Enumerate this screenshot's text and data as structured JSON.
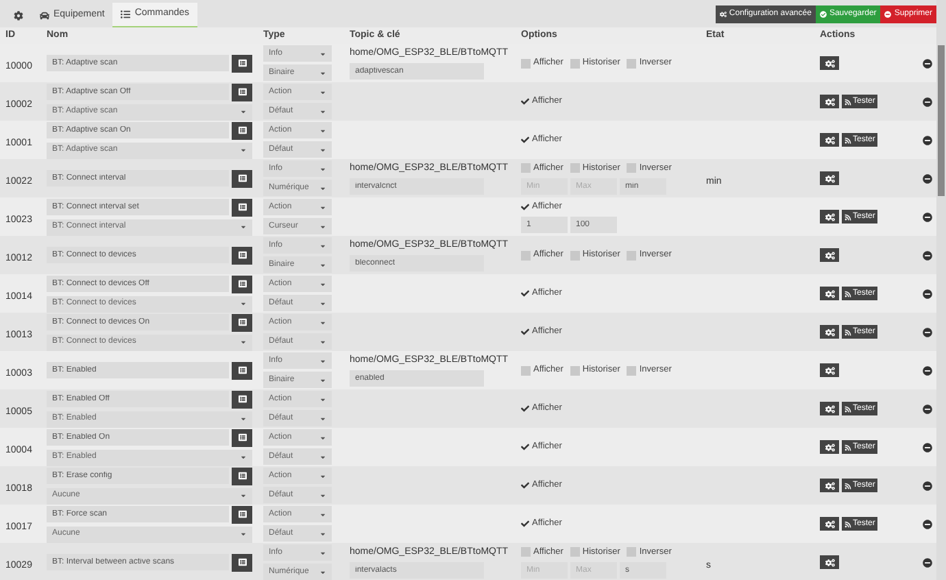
{
  "tabs": [
    {
      "kind": "icon",
      "selected": false
    },
    {
      "kind": "equipment",
      "label": "Equipement",
      "selected": false
    },
    {
      "kind": "commands",
      "label": "Commandes",
      "selected": true
    }
  ],
  "actions": [
    {
      "kind": "config",
      "label": "Configuration avancée"
    },
    {
      "kind": "save",
      "label": "Sauvegarder"
    },
    {
      "kind": "delete",
      "label": "Supprimer"
    }
  ],
  "columns": [
    "ID",
    "Nom",
    "Type",
    "Topic & clé",
    "Options",
    "Etat",
    "Actions"
  ],
  "rows": [
    {
      "kind": "info",
      "id": "10000",
      "name": "BT: Adaptive scan",
      "type": "Info",
      "subtype": "Binaire",
      "topic": "home/OMG_ESP32_BLE/BTtoMQTT",
      "key": "adaptivescan",
      "options": [
        {
          "label": "Afficher",
          "checked": false
        },
        {
          "label": "Historiser",
          "checked": false
        },
        {
          "label": "Inverser",
          "checked": false
        }
      ]
    },
    {
      "kind": "action",
      "id": "10002",
      "name": "BT: Adaptive scan Off",
      "value": "BT: Adaptive scan",
      "type": "Action",
      "subtype": "Défaut",
      "options": [
        {
          "label": "Afficher",
          "checked": true
        }
      ],
      "test": "Tester"
    },
    {
      "kind": "action",
      "id": "10001",
      "name": "BT: Adaptive scan On",
      "value": "BT: Adaptive scan",
      "type": "Action",
      "subtype": "Défaut",
      "options": [
        {
          "label": "Afficher",
          "checked": true
        }
      ],
      "test": "Tester"
    },
    {
      "kind": "info",
      "id": "10022",
      "name": "BT: Connect interval",
      "type": "Info",
      "subtype": "Numérique",
      "topic": "home/OMG_ESP32_BLE/BTtoMQTT",
      "key": "intervalcnct",
      "options": [
        {
          "label": "Afficher",
          "checked": false
        },
        {
          "label": "Historiser",
          "checked": false
        },
        {
          "label": "Inverser",
          "checked": false
        }
      ],
      "range": {
        "min_placeholder": "Min",
        "max_placeholder": "Max",
        "unit": "min"
      },
      "state": "min"
    },
    {
      "kind": "action",
      "id": "10023",
      "name": "BT: Connect interval set",
      "value": "BT: Connect interval",
      "type": "Action",
      "subtype": "Curseur",
      "options": [
        {
          "label": "Afficher",
          "checked": true
        }
      ],
      "range": {
        "min": "1",
        "max": "100"
      },
      "test": "Tester"
    },
    {
      "kind": "info",
      "id": "10012",
      "name": "BT: Connect to devices",
      "type": "Info",
      "subtype": "Binaire",
      "topic": "home/OMG_ESP32_BLE/BTtoMQTT",
      "key": "bleconnect",
      "options": [
        {
          "label": "Afficher",
          "checked": false
        },
        {
          "label": "Historiser",
          "checked": false
        },
        {
          "label": "Inverser",
          "checked": false
        }
      ]
    },
    {
      "kind": "action",
      "id": "10014",
      "name": "BT: Connect to devices Off",
      "value": "BT: Connect to devices",
      "type": "Action",
      "subtype": "Défaut",
      "options": [
        {
          "label": "Afficher",
          "checked": true
        }
      ],
      "test": "Tester"
    },
    {
      "kind": "action",
      "id": "10013",
      "name": "BT: Connect to devices On",
      "value": "BT: Connect to devices",
      "type": "Action",
      "subtype": "Défaut",
      "options": [
        {
          "label": "Afficher",
          "checked": true
        }
      ],
      "test": "Tester"
    },
    {
      "kind": "info",
      "id": "10003",
      "name": "BT: Enabled",
      "type": "Info",
      "subtype": "Binaire",
      "topic": "home/OMG_ESP32_BLE/BTtoMQTT",
      "key": "enabled",
      "options": [
        {
          "label": "Afficher",
          "checked": false
        },
        {
          "label": "Historiser",
          "checked": false
        },
        {
          "label": "Inverser",
          "checked": false
        }
      ]
    },
    {
      "kind": "action",
      "id": "10005",
      "name": "BT: Enabled Off",
      "value": "BT: Enabled",
      "type": "Action",
      "subtype": "Défaut",
      "options": [
        {
          "label": "Afficher",
          "checked": true
        }
      ],
      "test": "Tester"
    },
    {
      "kind": "action",
      "id": "10004",
      "name": "BT: Enabled On",
      "value": "BT: Enabled",
      "type": "Action",
      "subtype": "Défaut",
      "options": [
        {
          "label": "Afficher",
          "checked": true
        }
      ],
      "test": "Tester"
    },
    {
      "kind": "action",
      "id": "10018",
      "name": "BT: Erase config",
      "value": "Aucune",
      "type": "Action",
      "subtype": "Défaut",
      "options": [
        {
          "label": "Afficher",
          "checked": true
        }
      ],
      "test": "Tester"
    },
    {
      "kind": "action",
      "id": "10017",
      "name": "BT: Force scan",
      "value": "Aucune",
      "type": "Action",
      "subtype": "Défaut",
      "options": [
        {
          "label": "Afficher",
          "checked": true
        }
      ],
      "test": "Tester"
    },
    {
      "kind": "info",
      "id": "10029",
      "name": "BT: Interval between active scans",
      "type": "Info",
      "subtype": "Numérique",
      "topic": "home/OMG_ESP32_BLE/BTtoMQTT",
      "key": "intervalacts",
      "options": [
        {
          "label": "Afficher",
          "checked": false
        },
        {
          "label": "Historiser",
          "checked": false
        },
        {
          "label": "Inverser",
          "checked": false
        }
      ],
      "range": {
        "min_placeholder": "Min",
        "max_placeholder": "Max",
        "unit": "s"
      },
      "state": "s"
    }
  ]
}
